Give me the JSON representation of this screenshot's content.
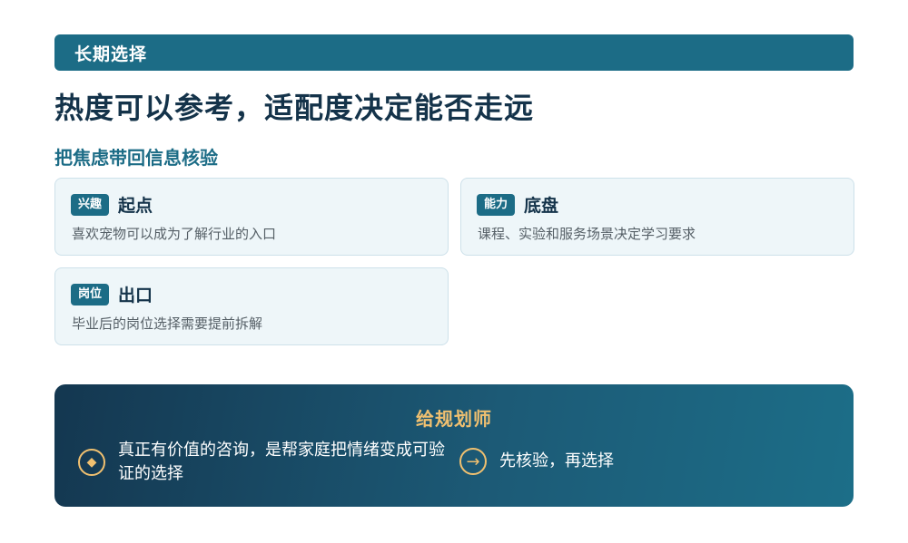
{
  "banner": {
    "label": "长期选择"
  },
  "headline": "热度可以参考，适配度决定能否走远",
  "subheading": "把焦虑带回信息核验",
  "cards": [
    {
      "tag": "兴趣",
      "title": "起点",
      "desc": "喜欢宠物可以成为了解行业的入口"
    },
    {
      "tag": "能力",
      "title": "底盘",
      "desc": "课程、实验和服务场景决定学习要求"
    },
    {
      "tag": "岗位",
      "title": "出口",
      "desc": "毕业后的岗位选择需要提前拆解"
    }
  ],
  "advice": {
    "title": "给规划师",
    "points": [
      {
        "icon": "diamond-icon",
        "glyph": "◆",
        "text": "真正有价值的咨询，是帮家庭把情绪变成可验证的选择"
      },
      {
        "icon": "arrow-right-icon",
        "glyph": "→",
        "text": "先核验，再选择"
      }
    ]
  },
  "colors": {
    "primary": "#1c6c86",
    "heading": "#14334a",
    "card_bg": "#eef6f9",
    "accent_gold": "#f0c070"
  }
}
